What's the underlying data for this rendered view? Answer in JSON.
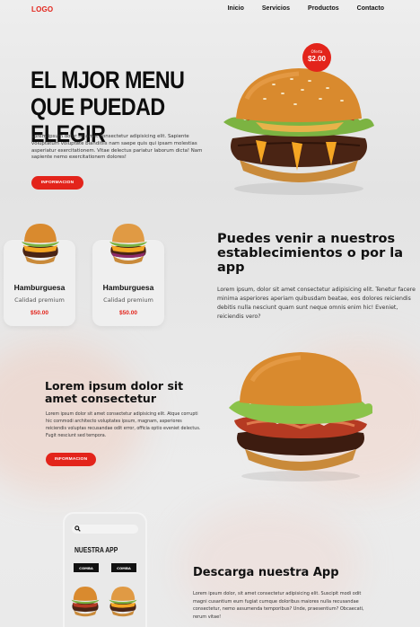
{
  "nav": {
    "logo": "LOGO",
    "items": [
      "Inicio",
      "Servicios",
      "Productos",
      "Contacto"
    ]
  },
  "hero": {
    "title": "EL MJOR MENU QUE PUEDAD ELEGIR",
    "text": "Lorem ipsum dolor sit amet consectetur adipisicing elit. Sapiente voluptatum voluptate blanditiis nam saepe quis qui ipsam molestias asperiatur exercitationem. Vitae delectus pariatur laborum dicta! Nam sapiente nemo exercitationem dolores!",
    "button": "INFORMACION",
    "offer_label": "Oferta",
    "offer_price": "$2.00"
  },
  "cards": [
    {
      "title": "Hamburguesa",
      "subtitle": "Calidad premium",
      "price": "$50.00"
    },
    {
      "title": "Hamburguesa",
      "subtitle": "Calidad premium",
      "price": "$50.00"
    }
  ],
  "section2": {
    "title": "Puedes venir a nuestros establecimientos o por la app",
    "text": "Lorem ipsum, dolor sit amet consectetur adipisicing elit. Tenetur facere minima asperiores aperiam quibusdam beatae, eos dolores reiciendis debitis nulla nesciunt quam sunt neque omnis enim hic! Eveniet, reiciendis vero?"
  },
  "section3": {
    "title": "Lorem ipsum dolor sit amet consectetur",
    "text": "Lorem ipsum dolor sit amet consectetur adipisicing elit. Atque corrupti hic commodi architecto voluptates ipsum, magnam, asperiores reiciendis voluptas recusandae odit error, officia optio eveniet delectus. Fugit nesciunt sed tempora.",
    "button": "INFORMACION"
  },
  "app": {
    "phone_title": "NUESTRA APP",
    "combo_labels": [
      "COMBA",
      "COMBA"
    ],
    "title": "Descarga nuestra App",
    "text": "Lorem ipsum dolor, sit amet consectetur adipisicing elit. Suscipit modi odit magni cusantium eum fugiat cumque doloribus maiores nulla recusandae consectetur, nemo assumenda temporibus? Unde, praesentium? Obcaecati, rerum vitae!"
  },
  "colors": {
    "accent": "#e3241b",
    "text": "#111111",
    "background": "#e6e6e6"
  }
}
